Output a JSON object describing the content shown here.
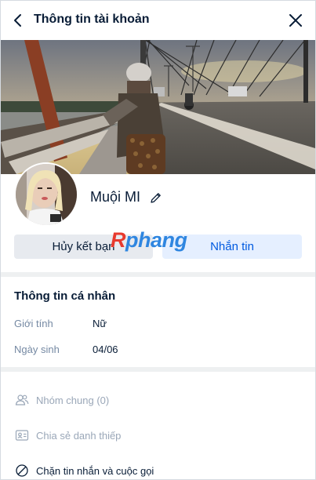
{
  "header": {
    "title": "Thông tin tài khoản",
    "back_icon": "chevron-left-icon",
    "close_icon": "close-icon"
  },
  "profile": {
    "name": "Muội MI",
    "edit_icon": "pencil-icon"
  },
  "actions": {
    "unfriend_label": "Hủy kết bạn",
    "message_label": "Nhắn tin"
  },
  "watermark": {
    "first": "R",
    "rest": "phang"
  },
  "personal_info": {
    "title": "Thông tin cá nhân",
    "rows": [
      {
        "label": "Giới tính",
        "value": "Nữ"
      },
      {
        "label": "Ngày sinh",
        "value": "04/06"
      }
    ]
  },
  "menu": [
    {
      "label": "Nhóm chung (0)",
      "icon": "users-icon"
    },
    {
      "label": "Chia sẻ danh thiếp",
      "icon": "contact-card-icon"
    },
    {
      "label": "Chặn tin nhắn và cuộc gọi",
      "icon": "block-icon"
    }
  ],
  "colors": {
    "primary": "#005ae0",
    "secondary_bg": "#e7eaef",
    "primary_bg": "#e5efff",
    "muted": "#7589a3"
  }
}
